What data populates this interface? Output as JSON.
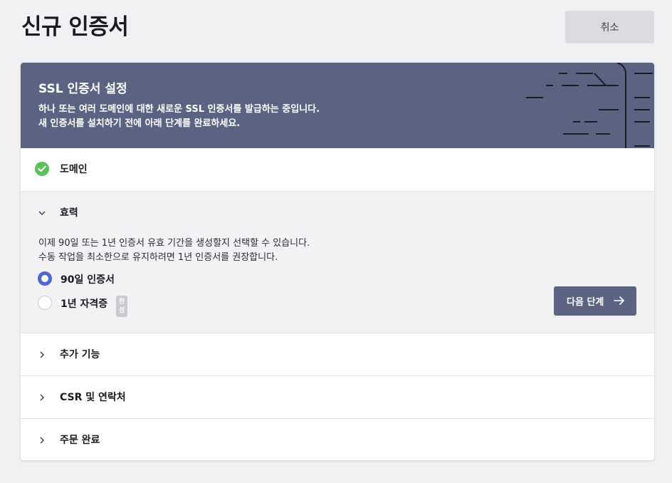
{
  "header": {
    "title": "신규 인증서",
    "cancel_label": "취소"
  },
  "hero": {
    "title": "SSL 인증서 설정",
    "desc_line1": "하나 또는 여러 도메인에 대한 새로운 SSL 인증서를 발급하는 중입니다.",
    "desc_line2": "새 인증서를 설치하기 전에 아래 단계를 완료하세요."
  },
  "steps": {
    "domain": {
      "label": "도메인",
      "status": "completed"
    },
    "validity": {
      "label": "효력",
      "desc_line1": "이제 90일 또는 1년 인증서 유효 기간을 생성할지 선택할 수 있습니다.",
      "desc_line2": "수동 작업을 최소한으로 유지하려면 1년 인증서를 권장합니다.",
      "options": [
        {
          "label": "90일 인증서",
          "selected": true
        },
        {
          "label": "1년 자격증",
          "selected": false,
          "badge": "찬성"
        }
      ],
      "badge_line1": "찬",
      "badge_line2": "성",
      "next_label": "다음 단계"
    },
    "features": {
      "label": "추가 기능"
    },
    "csr": {
      "label": "CSR 및 연락처"
    },
    "complete": {
      "label": "주문 완료"
    }
  },
  "colors": {
    "accent": "#5a6482",
    "radio_selected": "#4f67d0",
    "success": "#5cc05c",
    "background": "#f1f1f3"
  }
}
